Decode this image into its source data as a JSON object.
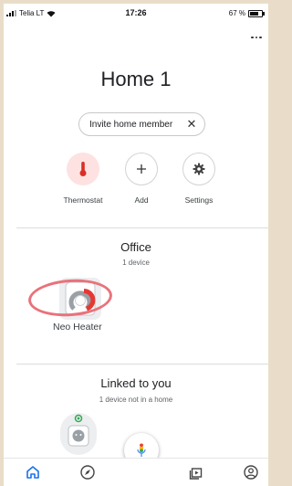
{
  "status_bar": {
    "carrier": "Telia LT",
    "time": "17:26",
    "battery": "67 %",
    "battery_level": 0.67
  },
  "home": {
    "title": "Home 1",
    "invite_label": "Invite home member"
  },
  "actions": [
    {
      "label": "Thermostat",
      "icon": "thermometer-icon"
    },
    {
      "label": "Add",
      "icon": "plus-icon"
    },
    {
      "label": "Settings",
      "icon": "gear-icon"
    }
  ],
  "office": {
    "title": "Office",
    "subtitle": "1 device",
    "device_name": "Neo Heater"
  },
  "linked": {
    "title": "Linked to you",
    "subtitle": "1 device not in a home"
  },
  "nav": {
    "items": [
      "home-icon",
      "compass-icon",
      "media-icon",
      "account-icon"
    ],
    "mic_icon": "microphone-icon"
  },
  "colors": {
    "accent_blue": "#1a73e8",
    "thermostat_bg": "#fde2e1",
    "thermostat_icon": "#d93025",
    "heater_red": "#e53935",
    "annotation_circle": "#e9727a",
    "online_green": "#34a853"
  }
}
